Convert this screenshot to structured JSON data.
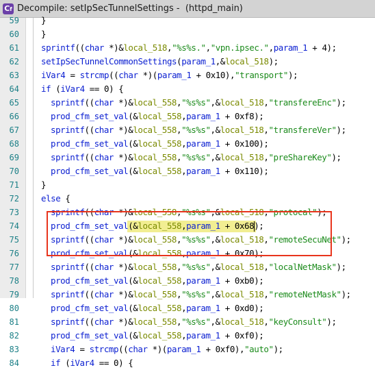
{
  "window": {
    "title": "Decompile: setIpSecTunnelSettings -  (httpd_main)",
    "icon": "decompile-icon",
    "accent": "#6b3fa8"
  },
  "colors": {
    "keyword": "#0b1fd1",
    "local": "#7a8a00",
    "string": "#1c8b1c",
    "line_number": "#1b7f86",
    "box": "#e8341c",
    "highlight": "#f2ee92"
  },
  "code": {
    "lines": [
      {
        "num": "59",
        "indent": 1,
        "tokens": [
          {
            "t": "}",
            "c": "pun"
          }
        ]
      },
      {
        "num": "60",
        "indent": 1,
        "tokens": [
          {
            "t": "}",
            "c": "pun"
          }
        ]
      },
      {
        "num": "61",
        "indent": 1,
        "tokens": [
          {
            "t": "sprintf",
            "c": "fn"
          },
          {
            "t": "((",
            "c": "pun"
          },
          {
            "t": "char",
            "c": "ty"
          },
          {
            "t": " *)&",
            "c": "pun"
          },
          {
            "t": "local_518",
            "c": "loc"
          },
          {
            "t": ",",
            "c": "pun"
          },
          {
            "t": "\"%s%s.\"",
            "c": "str"
          },
          {
            "t": ",",
            "c": "pun"
          },
          {
            "t": "\"vpn.ipsec.\"",
            "c": "str"
          },
          {
            "t": ",",
            "c": "pun"
          },
          {
            "t": "param_1",
            "c": "var"
          },
          {
            "t": " + 4);",
            "c": "pun"
          }
        ]
      },
      {
        "num": "62",
        "indent": 1,
        "tokens": [
          {
            "t": "setIpSecTunnelCommonSettings",
            "c": "fn"
          },
          {
            "t": "(",
            "c": "pun"
          },
          {
            "t": "param_1",
            "c": "var"
          },
          {
            "t": ",&",
            "c": "pun"
          },
          {
            "t": "local_518",
            "c": "loc"
          },
          {
            "t": ");",
            "c": "pun"
          }
        ]
      },
      {
        "num": "63",
        "indent": 1,
        "tokens": [
          {
            "t": "iVar4",
            "c": "var"
          },
          {
            "t": " = ",
            "c": "pun"
          },
          {
            "t": "strcmp",
            "c": "fn"
          },
          {
            "t": "((",
            "c": "pun"
          },
          {
            "t": "char",
            "c": "ty"
          },
          {
            "t": " *)(",
            "c": "pun"
          },
          {
            "t": "param_1",
            "c": "var"
          },
          {
            "t": " + 0x10),",
            "c": "pun"
          },
          {
            "t": "\"transport\"",
            "c": "str"
          },
          {
            "t": ");",
            "c": "pun"
          }
        ]
      },
      {
        "num": "64",
        "indent": 1,
        "tokens": [
          {
            "t": "if",
            "c": "kw"
          },
          {
            "t": " (",
            "c": "pun"
          },
          {
            "t": "iVar4",
            "c": "var"
          },
          {
            "t": " == 0) {",
            "c": "pun"
          }
        ]
      },
      {
        "num": "65",
        "indent": 2,
        "tokens": [
          {
            "t": "sprintf",
            "c": "fn"
          },
          {
            "t": "((",
            "c": "pun"
          },
          {
            "t": "char",
            "c": "ty"
          },
          {
            "t": " *)&",
            "c": "pun"
          },
          {
            "t": "local_558",
            "c": "loc"
          },
          {
            "t": ",",
            "c": "pun"
          },
          {
            "t": "\"%s%s\"",
            "c": "str"
          },
          {
            "t": ",&",
            "c": "pun"
          },
          {
            "t": "local_518",
            "c": "loc"
          },
          {
            "t": ",",
            "c": "pun"
          },
          {
            "t": "\"transfereEnc\"",
            "c": "str"
          },
          {
            "t": ");",
            "c": "pun"
          }
        ]
      },
      {
        "num": "66",
        "indent": 2,
        "tokens": [
          {
            "t": "prod_cfm_set_val",
            "c": "fn"
          },
          {
            "t": "(&",
            "c": "pun"
          },
          {
            "t": "local_558",
            "c": "loc"
          },
          {
            "t": ",",
            "c": "pun"
          },
          {
            "t": "param_1",
            "c": "var"
          },
          {
            "t": " + 0xf8);",
            "c": "pun"
          }
        ]
      },
      {
        "num": "67",
        "indent": 2,
        "tokens": [
          {
            "t": "sprintf",
            "c": "fn"
          },
          {
            "t": "((",
            "c": "pun"
          },
          {
            "t": "char",
            "c": "ty"
          },
          {
            "t": " *)&",
            "c": "pun"
          },
          {
            "t": "local_558",
            "c": "loc"
          },
          {
            "t": ",",
            "c": "pun"
          },
          {
            "t": "\"%s%s\"",
            "c": "str"
          },
          {
            "t": ",&",
            "c": "pun"
          },
          {
            "t": "local_518",
            "c": "loc"
          },
          {
            "t": ",",
            "c": "pun"
          },
          {
            "t": "\"transfereVer\"",
            "c": "str"
          },
          {
            "t": ");",
            "c": "pun"
          }
        ]
      },
      {
        "num": "68",
        "indent": 2,
        "tokens": [
          {
            "t": "prod_cfm_set_val",
            "c": "fn"
          },
          {
            "t": "(&",
            "c": "pun"
          },
          {
            "t": "local_558",
            "c": "loc"
          },
          {
            "t": ",",
            "c": "pun"
          },
          {
            "t": "param_1",
            "c": "var"
          },
          {
            "t": " + 0x100);",
            "c": "pun"
          }
        ]
      },
      {
        "num": "69",
        "indent": 2,
        "tokens": [
          {
            "t": "sprintf",
            "c": "fn"
          },
          {
            "t": "((",
            "c": "pun"
          },
          {
            "t": "char",
            "c": "ty"
          },
          {
            "t": " *)&",
            "c": "pun"
          },
          {
            "t": "local_558",
            "c": "loc"
          },
          {
            "t": ",",
            "c": "pun"
          },
          {
            "t": "\"%s%s\"",
            "c": "str"
          },
          {
            "t": ",&",
            "c": "pun"
          },
          {
            "t": "local_518",
            "c": "loc"
          },
          {
            "t": ",",
            "c": "pun"
          },
          {
            "t": "\"preShareKey\"",
            "c": "str"
          },
          {
            "t": ");",
            "c": "pun"
          }
        ]
      },
      {
        "num": "70",
        "indent": 2,
        "tokens": [
          {
            "t": "prod_cfm_set_val",
            "c": "fn"
          },
          {
            "t": "(&",
            "c": "pun"
          },
          {
            "t": "local_558",
            "c": "loc"
          },
          {
            "t": ",",
            "c": "pun"
          },
          {
            "t": "param_1",
            "c": "var"
          },
          {
            "t": " + 0x110);",
            "c": "pun"
          }
        ]
      },
      {
        "num": "71",
        "indent": 1,
        "tokens": [
          {
            "t": "}",
            "c": "pun"
          }
        ]
      },
      {
        "num": "72",
        "indent": 1,
        "tokens": [
          {
            "t": "else",
            "c": "kw"
          },
          {
            "t": " {",
            "c": "pun"
          }
        ]
      },
      {
        "num": "73",
        "indent": 2,
        "tokens": [
          {
            "t": "sprintf",
            "c": "fn"
          },
          {
            "t": "((",
            "c": "pun"
          },
          {
            "t": "char",
            "c": "ty"
          },
          {
            "t": " *)&",
            "c": "pun"
          },
          {
            "t": "local_558",
            "c": "loc"
          },
          {
            "t": ",",
            "c": "pun"
          },
          {
            "t": "\"%s%s\"",
            "c": "str"
          },
          {
            "t": ",&",
            "c": "pun"
          },
          {
            "t": "local_518",
            "c": "loc"
          },
          {
            "t": ",",
            "c": "pun"
          },
          {
            "t": "\"protocal\"",
            "c": "str"
          },
          {
            "t": ");",
            "c": "pun"
          }
        ]
      },
      {
        "num": "74",
        "indent": 2,
        "tokens": [
          {
            "t": "prod_cfm_set_val",
            "c": "fn"
          },
          {
            "t": "(&",
            "c": "pun"
          },
          {
            "t": "local_558",
            "c": "loc"
          },
          {
            "t": ",",
            "c": "pun"
          },
          {
            "t": "param_1",
            "c": "var"
          },
          {
            "t": " + 0x68);",
            "c": "pun"
          }
        ]
      },
      {
        "num": "75",
        "indent": 2,
        "tokens": [
          {
            "t": "sprintf",
            "c": "fn"
          },
          {
            "t": "((",
            "c": "pun"
          },
          {
            "t": "char",
            "c": "ty"
          },
          {
            "t": " *)&",
            "c": "pun"
          },
          {
            "t": "local_558",
            "c": "loc"
          },
          {
            "t": ",",
            "c": "pun"
          },
          {
            "t": "\"%s%s\"",
            "c": "str"
          },
          {
            "t": ",&",
            "c": "pun"
          },
          {
            "t": "local_518",
            "c": "loc"
          },
          {
            "t": ",",
            "c": "pun"
          },
          {
            "t": "\"remoteSecuNet\"",
            "c": "str"
          },
          {
            "t": ");",
            "c": "pun"
          }
        ]
      },
      {
        "num": "76",
        "indent": 2,
        "tokens": [
          {
            "t": "prod_cfm_set_val",
            "c": "fn"
          },
          {
            "t": "(&",
            "c": "pun"
          },
          {
            "t": "local_558",
            "c": "loc"
          },
          {
            "t": ",",
            "c": "pun"
          },
          {
            "t": "param_1",
            "c": "var"
          },
          {
            "t": " + 0x70);",
            "c": "pun"
          }
        ]
      },
      {
        "num": "77",
        "indent": 2,
        "tokens": [
          {
            "t": "sprintf",
            "c": "fn"
          },
          {
            "t": "((",
            "c": "pun"
          },
          {
            "t": "char",
            "c": "ty"
          },
          {
            "t": " *)&",
            "c": "pun"
          },
          {
            "t": "local_558",
            "c": "loc"
          },
          {
            "t": ",",
            "c": "pun"
          },
          {
            "t": "\"%s%s\"",
            "c": "str"
          },
          {
            "t": ",&",
            "c": "pun"
          },
          {
            "t": "local_518",
            "c": "loc"
          },
          {
            "t": ",",
            "c": "pun"
          },
          {
            "t": "\"localNetMask\"",
            "c": "str"
          },
          {
            "t": ");",
            "c": "pun"
          }
        ]
      },
      {
        "num": "78",
        "indent": 2,
        "tokens": [
          {
            "t": "prod_cfm_set_val",
            "c": "fn"
          },
          {
            "t": "(&",
            "c": "pun"
          },
          {
            "t": "local_558",
            "c": "loc"
          },
          {
            "t": ",",
            "c": "pun"
          },
          {
            "t": "param_1",
            "c": "var"
          },
          {
            "t": " + 0xb0);",
            "c": "pun"
          }
        ]
      },
      {
        "num": "79",
        "indent": 2,
        "tokens": [
          {
            "t": "sprintf",
            "c": "fn"
          },
          {
            "t": "((",
            "c": "pun"
          },
          {
            "t": "char",
            "c": "ty"
          },
          {
            "t": " *)&",
            "c": "pun"
          },
          {
            "t": "local_558",
            "c": "loc"
          },
          {
            "t": ",",
            "c": "pun"
          },
          {
            "t": "\"%s%s\"",
            "c": "str"
          },
          {
            "t": ",&",
            "c": "pun"
          },
          {
            "t": "local_518",
            "c": "loc"
          },
          {
            "t": ",",
            "c": "pun"
          },
          {
            "t": "\"remoteNetMask\"",
            "c": "str"
          },
          {
            "t": ");",
            "c": "pun"
          }
        ]
      },
      {
        "num": "80",
        "indent": 2,
        "tokens": [
          {
            "t": "prod_cfm_set_val",
            "c": "fn"
          },
          {
            "t": "(&",
            "c": "pun"
          },
          {
            "t": "local_558",
            "c": "loc"
          },
          {
            "t": ",",
            "c": "pun"
          },
          {
            "t": "param_1",
            "c": "var"
          },
          {
            "t": " + 0xd0);",
            "c": "pun"
          }
        ]
      },
      {
        "num": "81",
        "indent": 2,
        "tokens": [
          {
            "t": "sprintf",
            "c": "fn"
          },
          {
            "t": "((",
            "c": "pun"
          },
          {
            "t": "char",
            "c": "ty"
          },
          {
            "t": " *)&",
            "c": "pun"
          },
          {
            "t": "local_558",
            "c": "loc"
          },
          {
            "t": ",",
            "c": "pun"
          },
          {
            "t": "\"%s%s\"",
            "c": "str"
          },
          {
            "t": ",&",
            "c": "pun"
          },
          {
            "t": "local_518",
            "c": "loc"
          },
          {
            "t": ",",
            "c": "pun"
          },
          {
            "t": "\"keyConsult\"",
            "c": "str"
          },
          {
            "t": ");",
            "c": "pun"
          }
        ]
      },
      {
        "num": "82",
        "indent": 2,
        "tokens": [
          {
            "t": "prod_cfm_set_val",
            "c": "fn"
          },
          {
            "t": "(&",
            "c": "pun"
          },
          {
            "t": "local_558",
            "c": "loc"
          },
          {
            "t": ",",
            "c": "pun"
          },
          {
            "t": "param_1",
            "c": "var"
          },
          {
            "t": " + 0xf0);",
            "c": "pun"
          }
        ]
      },
      {
        "num": "83",
        "indent": 2,
        "tokens": [
          {
            "t": "iVar4",
            "c": "var"
          },
          {
            "t": " = ",
            "c": "pun"
          },
          {
            "t": "strcmp",
            "c": "fn"
          },
          {
            "t": "((",
            "c": "pun"
          },
          {
            "t": "char",
            "c": "ty"
          },
          {
            "t": " *)(",
            "c": "pun"
          },
          {
            "t": "param_1",
            "c": "var"
          },
          {
            "t": " + 0xf0),",
            "c": "pun"
          },
          {
            "t": "\"auto\"",
            "c": "str"
          },
          {
            "t": ");",
            "c": "pun"
          }
        ]
      },
      {
        "num": "84",
        "indent": 2,
        "tokens": [
          {
            "t": "if",
            "c": "kw"
          },
          {
            "t": " (",
            "c": "pun"
          },
          {
            "t": "iVar4",
            "c": "var"
          },
          {
            "t": " == 0) {",
            "c": "pun"
          }
        ]
      }
    ]
  }
}
